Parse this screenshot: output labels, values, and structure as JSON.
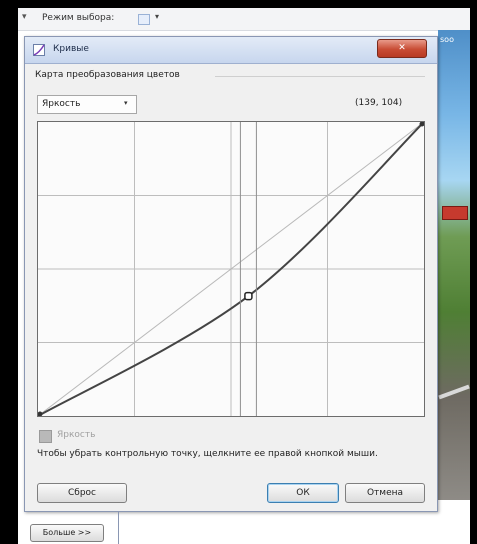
{
  "toolbar": {
    "mode_label": "Режим выбора:",
    "mode_icon": "selection-mode-icon",
    "dropdown_arrow": "▾",
    "left_arrow": "▾"
  },
  "background": {
    "sky_label": "soo"
  },
  "dialog": {
    "title": "Кривые",
    "title_icon": "curves-icon",
    "close_label": "✕",
    "group_title": "Карта преобразования цветов",
    "channel_select": {
      "value": "Яркость",
      "arrow": "▾"
    },
    "coordinates": "(139, 104)",
    "curve": {
      "range": [
        0,
        255
      ],
      "control_points": [
        [
          0,
          0
        ],
        [
          139,
          104
        ],
        [
          255,
          255
        ]
      ],
      "selected_point": [
        139,
        104
      ]
    },
    "checkbox_label": "Яркость",
    "hint": "Чтобы убрать контрольную точку, щелкните ее правой кнопкой мыши.",
    "buttons": {
      "reset": "Сброс",
      "ok": "ОК",
      "cancel": "Отмена"
    }
  },
  "more_button": "Больше >>",
  "colors": {
    "accent": "#3c7fb1",
    "close": "#c84c34",
    "curve": "#444444",
    "diagonal": "#b9b9b9",
    "grid": "#bdbdbd"
  }
}
